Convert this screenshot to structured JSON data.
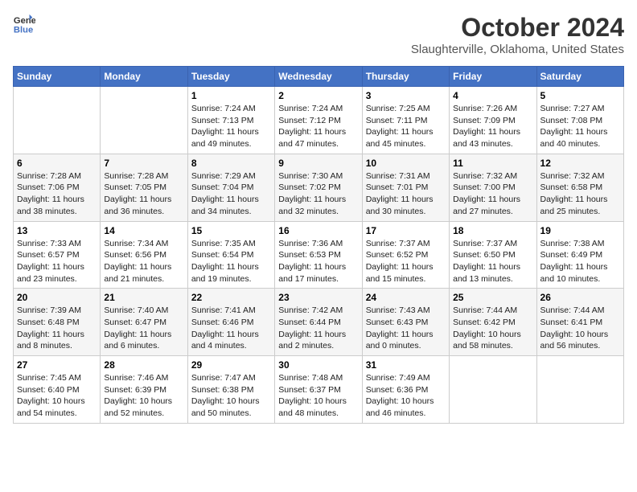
{
  "logo": {
    "line1": "General",
    "line2": "Blue"
  },
  "title": "October 2024",
  "location": "Slaughterville, Oklahoma, United States",
  "days_of_week": [
    "Sunday",
    "Monday",
    "Tuesday",
    "Wednesday",
    "Thursday",
    "Friday",
    "Saturday"
  ],
  "weeks": [
    [
      {
        "day": "",
        "sunrise": "",
        "sunset": "",
        "daylight": ""
      },
      {
        "day": "",
        "sunrise": "",
        "sunset": "",
        "daylight": ""
      },
      {
        "day": "1",
        "sunrise": "Sunrise: 7:24 AM",
        "sunset": "Sunset: 7:13 PM",
        "daylight": "Daylight: 11 hours and 49 minutes."
      },
      {
        "day": "2",
        "sunrise": "Sunrise: 7:24 AM",
        "sunset": "Sunset: 7:12 PM",
        "daylight": "Daylight: 11 hours and 47 minutes."
      },
      {
        "day": "3",
        "sunrise": "Sunrise: 7:25 AM",
        "sunset": "Sunset: 7:11 PM",
        "daylight": "Daylight: 11 hours and 45 minutes."
      },
      {
        "day": "4",
        "sunrise": "Sunrise: 7:26 AM",
        "sunset": "Sunset: 7:09 PM",
        "daylight": "Daylight: 11 hours and 43 minutes."
      },
      {
        "day": "5",
        "sunrise": "Sunrise: 7:27 AM",
        "sunset": "Sunset: 7:08 PM",
        "daylight": "Daylight: 11 hours and 40 minutes."
      }
    ],
    [
      {
        "day": "6",
        "sunrise": "Sunrise: 7:28 AM",
        "sunset": "Sunset: 7:06 PM",
        "daylight": "Daylight: 11 hours and 38 minutes."
      },
      {
        "day": "7",
        "sunrise": "Sunrise: 7:28 AM",
        "sunset": "Sunset: 7:05 PM",
        "daylight": "Daylight: 11 hours and 36 minutes."
      },
      {
        "day": "8",
        "sunrise": "Sunrise: 7:29 AM",
        "sunset": "Sunset: 7:04 PM",
        "daylight": "Daylight: 11 hours and 34 minutes."
      },
      {
        "day": "9",
        "sunrise": "Sunrise: 7:30 AM",
        "sunset": "Sunset: 7:02 PM",
        "daylight": "Daylight: 11 hours and 32 minutes."
      },
      {
        "day": "10",
        "sunrise": "Sunrise: 7:31 AM",
        "sunset": "Sunset: 7:01 PM",
        "daylight": "Daylight: 11 hours and 30 minutes."
      },
      {
        "day": "11",
        "sunrise": "Sunrise: 7:32 AM",
        "sunset": "Sunset: 7:00 PM",
        "daylight": "Daylight: 11 hours and 27 minutes."
      },
      {
        "day": "12",
        "sunrise": "Sunrise: 7:32 AM",
        "sunset": "Sunset: 6:58 PM",
        "daylight": "Daylight: 11 hours and 25 minutes."
      }
    ],
    [
      {
        "day": "13",
        "sunrise": "Sunrise: 7:33 AM",
        "sunset": "Sunset: 6:57 PM",
        "daylight": "Daylight: 11 hours and 23 minutes."
      },
      {
        "day": "14",
        "sunrise": "Sunrise: 7:34 AM",
        "sunset": "Sunset: 6:56 PM",
        "daylight": "Daylight: 11 hours and 21 minutes."
      },
      {
        "day": "15",
        "sunrise": "Sunrise: 7:35 AM",
        "sunset": "Sunset: 6:54 PM",
        "daylight": "Daylight: 11 hours and 19 minutes."
      },
      {
        "day": "16",
        "sunrise": "Sunrise: 7:36 AM",
        "sunset": "Sunset: 6:53 PM",
        "daylight": "Daylight: 11 hours and 17 minutes."
      },
      {
        "day": "17",
        "sunrise": "Sunrise: 7:37 AM",
        "sunset": "Sunset: 6:52 PM",
        "daylight": "Daylight: 11 hours and 15 minutes."
      },
      {
        "day": "18",
        "sunrise": "Sunrise: 7:37 AM",
        "sunset": "Sunset: 6:50 PM",
        "daylight": "Daylight: 11 hours and 13 minutes."
      },
      {
        "day": "19",
        "sunrise": "Sunrise: 7:38 AM",
        "sunset": "Sunset: 6:49 PM",
        "daylight": "Daylight: 11 hours and 10 minutes."
      }
    ],
    [
      {
        "day": "20",
        "sunrise": "Sunrise: 7:39 AM",
        "sunset": "Sunset: 6:48 PM",
        "daylight": "Daylight: 11 hours and 8 minutes."
      },
      {
        "day": "21",
        "sunrise": "Sunrise: 7:40 AM",
        "sunset": "Sunset: 6:47 PM",
        "daylight": "Daylight: 11 hours and 6 minutes."
      },
      {
        "day": "22",
        "sunrise": "Sunrise: 7:41 AM",
        "sunset": "Sunset: 6:46 PM",
        "daylight": "Daylight: 11 hours and 4 minutes."
      },
      {
        "day": "23",
        "sunrise": "Sunrise: 7:42 AM",
        "sunset": "Sunset: 6:44 PM",
        "daylight": "Daylight: 11 hours and 2 minutes."
      },
      {
        "day": "24",
        "sunrise": "Sunrise: 7:43 AM",
        "sunset": "Sunset: 6:43 PM",
        "daylight": "Daylight: 11 hours and 0 minutes."
      },
      {
        "day": "25",
        "sunrise": "Sunrise: 7:44 AM",
        "sunset": "Sunset: 6:42 PM",
        "daylight": "Daylight: 10 hours and 58 minutes."
      },
      {
        "day": "26",
        "sunrise": "Sunrise: 7:44 AM",
        "sunset": "Sunset: 6:41 PM",
        "daylight": "Daylight: 10 hours and 56 minutes."
      }
    ],
    [
      {
        "day": "27",
        "sunrise": "Sunrise: 7:45 AM",
        "sunset": "Sunset: 6:40 PM",
        "daylight": "Daylight: 10 hours and 54 minutes."
      },
      {
        "day": "28",
        "sunrise": "Sunrise: 7:46 AM",
        "sunset": "Sunset: 6:39 PM",
        "daylight": "Daylight: 10 hours and 52 minutes."
      },
      {
        "day": "29",
        "sunrise": "Sunrise: 7:47 AM",
        "sunset": "Sunset: 6:38 PM",
        "daylight": "Daylight: 10 hours and 50 minutes."
      },
      {
        "day": "30",
        "sunrise": "Sunrise: 7:48 AM",
        "sunset": "Sunset: 6:37 PM",
        "daylight": "Daylight: 10 hours and 48 minutes."
      },
      {
        "day": "31",
        "sunrise": "Sunrise: 7:49 AM",
        "sunset": "Sunset: 6:36 PM",
        "daylight": "Daylight: 10 hours and 46 minutes."
      },
      {
        "day": "",
        "sunrise": "",
        "sunset": "",
        "daylight": ""
      },
      {
        "day": "",
        "sunrise": "",
        "sunset": "",
        "daylight": ""
      }
    ]
  ]
}
